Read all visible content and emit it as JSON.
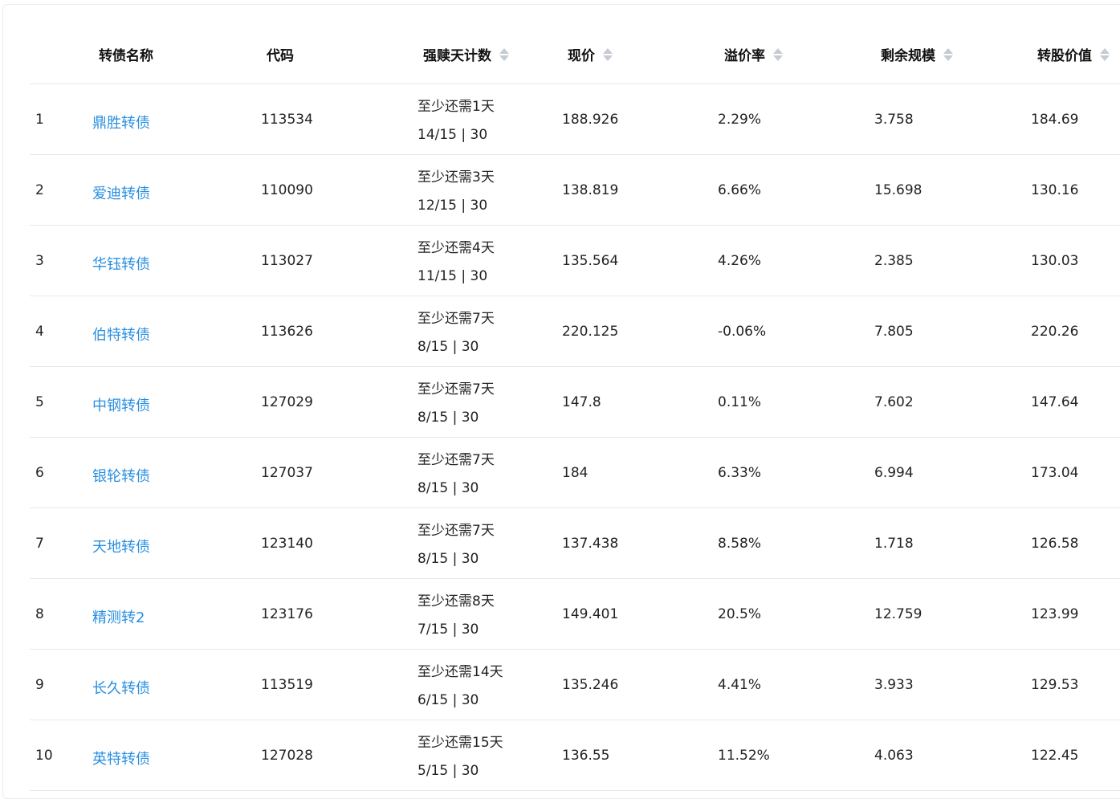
{
  "columns": {
    "name": "转债名称",
    "code": "代码",
    "days": "强赎天计数",
    "price": "现价",
    "premium": "溢价率",
    "remaining": "剩余规模",
    "conv_value": "转股价值"
  },
  "rows": [
    {
      "idx": "1",
      "name": "鼎胜转债",
      "code": "113534",
      "days_need": "至少还需1天",
      "days_count": "14/15 | 30",
      "price": "188.926",
      "premium": "2.29%",
      "remaining": "3.758",
      "conv_value": "184.69"
    },
    {
      "idx": "2",
      "name": "爱迪转债",
      "code": "110090",
      "days_need": "至少还需3天",
      "days_count": "12/15 | 30",
      "price": "138.819",
      "premium": "6.66%",
      "remaining": "15.698",
      "conv_value": "130.16"
    },
    {
      "idx": "3",
      "name": "华钰转债",
      "code": "113027",
      "days_need": "至少还需4天",
      "days_count": "11/15 | 30",
      "price": "135.564",
      "premium": "4.26%",
      "remaining": "2.385",
      "conv_value": "130.03"
    },
    {
      "idx": "4",
      "name": "伯特转债",
      "code": "113626",
      "days_need": "至少还需7天",
      "days_count": "8/15 | 30",
      "price": "220.125",
      "premium": "-0.06%",
      "remaining": "7.805",
      "conv_value": "220.26"
    },
    {
      "idx": "5",
      "name": "中钢转债",
      "code": "127029",
      "days_need": "至少还需7天",
      "days_count": "8/15 | 30",
      "price": "147.8",
      "premium": "0.11%",
      "remaining": "7.602",
      "conv_value": "147.64"
    },
    {
      "idx": "6",
      "name": "银轮转债",
      "code": "127037",
      "days_need": "至少还需7天",
      "days_count": "8/15 | 30",
      "price": "184",
      "premium": "6.33%",
      "remaining": "6.994",
      "conv_value": "173.04"
    },
    {
      "idx": "7",
      "name": "天地转债",
      "code": "123140",
      "days_need": "至少还需7天",
      "days_count": "8/15 | 30",
      "price": "137.438",
      "premium": "8.58%",
      "remaining": "1.718",
      "conv_value": "126.58"
    },
    {
      "idx": "8",
      "name": "精测转2",
      "code": "123176",
      "days_need": "至少还需8天",
      "days_count": "7/15 | 30",
      "price": "149.401",
      "premium": "20.5%",
      "remaining": "12.759",
      "conv_value": "123.99"
    },
    {
      "idx": "9",
      "name": "长久转债",
      "code": "113519",
      "days_need": "至少还需14天",
      "days_count": "6/15 | 30",
      "price": "135.246",
      "premium": "4.41%",
      "remaining": "3.933",
      "conv_value": "129.53"
    },
    {
      "idx": "10",
      "name": "英特转债",
      "code": "127028",
      "days_need": "至少还需15天",
      "days_count": "5/15 | 30",
      "price": "136.55",
      "premium": "11.52%",
      "remaining": "4.063",
      "conv_value": "122.45"
    }
  ],
  "colors": {
    "link": "#2a8fe0",
    "sort_icon": "#c6cbd3",
    "divider": "#e8e8e8"
  },
  "icons": {
    "sort": "sort-caret-icon"
  }
}
